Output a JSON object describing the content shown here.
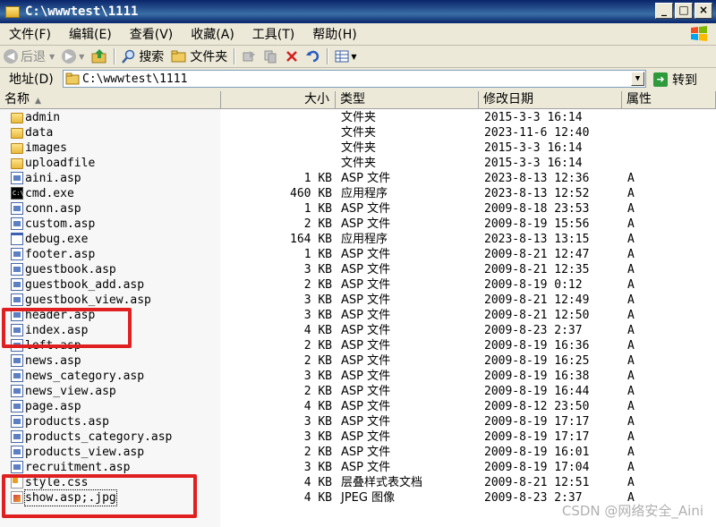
{
  "window": {
    "title": "C:\\wwwtest\\1111"
  },
  "menu": [
    {
      "label": "文件(F)"
    },
    {
      "label": "编辑(E)"
    },
    {
      "label": "查看(V)"
    },
    {
      "label": "收藏(A)"
    },
    {
      "label": "工具(T)"
    },
    {
      "label": "帮助(H)"
    }
  ],
  "toolbar": {
    "back_label": "后退",
    "search_label": "搜索",
    "folders_label": "文件夹"
  },
  "address": {
    "label": "地址(D)",
    "value": "C:\\wwwtest\\1111",
    "go_label": "转到"
  },
  "columns": {
    "name": "名称",
    "size": "大小",
    "type": "类型",
    "date": "修改日期",
    "attr": "属性"
  },
  "files": [
    {
      "name": "admin",
      "size": "",
      "type": "文件夹",
      "date": "2015-3-3 16:14",
      "attr": "",
      "icon": "folder-icon"
    },
    {
      "name": "data",
      "size": "",
      "type": "文件夹",
      "date": "2023-11-6 12:40",
      "attr": "",
      "icon": "folder-icon"
    },
    {
      "name": "images",
      "size": "",
      "type": "文件夹",
      "date": "2015-3-3 16:14",
      "attr": "",
      "icon": "folder-icon"
    },
    {
      "name": "uploadfile",
      "size": "",
      "type": "文件夹",
      "date": "2015-3-3 16:14",
      "attr": "",
      "icon": "folder-icon"
    },
    {
      "name": "aini.asp",
      "size": "1 KB",
      "type": "ASP 文件",
      "date": "2023-8-13 12:36",
      "attr": "A",
      "icon": "asp-file-icon"
    },
    {
      "name": "cmd.exe",
      "size": "460 KB",
      "type": "应用程序",
      "date": "2023-8-13 12:52",
      "attr": "A",
      "icon": "cmd-icon"
    },
    {
      "name": "conn.asp",
      "size": "1 KB",
      "type": "ASP 文件",
      "date": "2009-8-18 23:53",
      "attr": "A",
      "icon": "asp-file-icon"
    },
    {
      "name": "custom.asp",
      "size": "2 KB",
      "type": "ASP 文件",
      "date": "2009-8-19 15:56",
      "attr": "A",
      "icon": "asp-file-icon"
    },
    {
      "name": "debug.exe",
      "size": "164 KB",
      "type": "应用程序",
      "date": "2023-8-13 13:15",
      "attr": "A",
      "icon": "exe-icon"
    },
    {
      "name": "footer.asp",
      "size": "1 KB",
      "type": "ASP 文件",
      "date": "2009-8-21 12:47",
      "attr": "A",
      "icon": "asp-file-icon"
    },
    {
      "name": "guestbook.asp",
      "size": "3 KB",
      "type": "ASP 文件",
      "date": "2009-8-21 12:35",
      "attr": "A",
      "icon": "asp-file-icon"
    },
    {
      "name": "guestbook_add.asp",
      "size": "2 KB",
      "type": "ASP 文件",
      "date": "2009-8-19 0:12",
      "attr": "A",
      "icon": "asp-file-icon"
    },
    {
      "name": "guestbook_view.asp",
      "size": "3 KB",
      "type": "ASP 文件",
      "date": "2009-8-21 12:49",
      "attr": "A",
      "icon": "asp-file-icon"
    },
    {
      "name": "header.asp",
      "size": "3 KB",
      "type": "ASP 文件",
      "date": "2009-8-21 12:50",
      "attr": "A",
      "icon": "asp-file-icon"
    },
    {
      "name": "index.asp",
      "size": "4 KB",
      "type": "ASP 文件",
      "date": "2009-8-23 2:37",
      "attr": "A",
      "icon": "asp-file-icon"
    },
    {
      "name": "left.asp",
      "size": "2 KB",
      "type": "ASP 文件",
      "date": "2009-8-19 16:36",
      "attr": "A",
      "icon": "asp-file-icon"
    },
    {
      "name": "news.asp",
      "size": "2 KB",
      "type": "ASP 文件",
      "date": "2009-8-19 16:25",
      "attr": "A",
      "icon": "asp-file-icon"
    },
    {
      "name": "news_category.asp",
      "size": "3 KB",
      "type": "ASP 文件",
      "date": "2009-8-19 16:38",
      "attr": "A",
      "icon": "asp-file-icon"
    },
    {
      "name": "news_view.asp",
      "size": "2 KB",
      "type": "ASP 文件",
      "date": "2009-8-19 16:44",
      "attr": "A",
      "icon": "asp-file-icon"
    },
    {
      "name": "page.asp",
      "size": "4 KB",
      "type": "ASP 文件",
      "date": "2009-8-12 23:50",
      "attr": "A",
      "icon": "asp-file-icon"
    },
    {
      "name": "products.asp",
      "size": "3 KB",
      "type": "ASP 文件",
      "date": "2009-8-19 17:17",
      "attr": "A",
      "icon": "asp-file-icon"
    },
    {
      "name": "products_category.asp",
      "size": "3 KB",
      "type": "ASP 文件",
      "date": "2009-8-19 17:17",
      "attr": "A",
      "icon": "asp-file-icon"
    },
    {
      "name": "products_view.asp",
      "size": "2 KB",
      "type": "ASP 文件",
      "date": "2009-8-19 16:01",
      "attr": "A",
      "icon": "asp-file-icon"
    },
    {
      "name": "recruitment.asp",
      "size": "3 KB",
      "type": "ASP 文件",
      "date": "2009-8-19 17:04",
      "attr": "A",
      "icon": "asp-file-icon"
    },
    {
      "name": "style.css",
      "size": "4 KB",
      "type": "层叠样式表文档",
      "date": "2009-8-21 12:51",
      "attr": "A",
      "icon": "css-file-icon"
    },
    {
      "name": "show.asp;.jpg",
      "size": "4 KB",
      "type": "JPEG 图像",
      "date": "2009-8-23 2:37",
      "attr": "A",
      "icon": "jpeg-file-icon"
    }
  ],
  "watermark": "CSDN @网络安全_Aini"
}
